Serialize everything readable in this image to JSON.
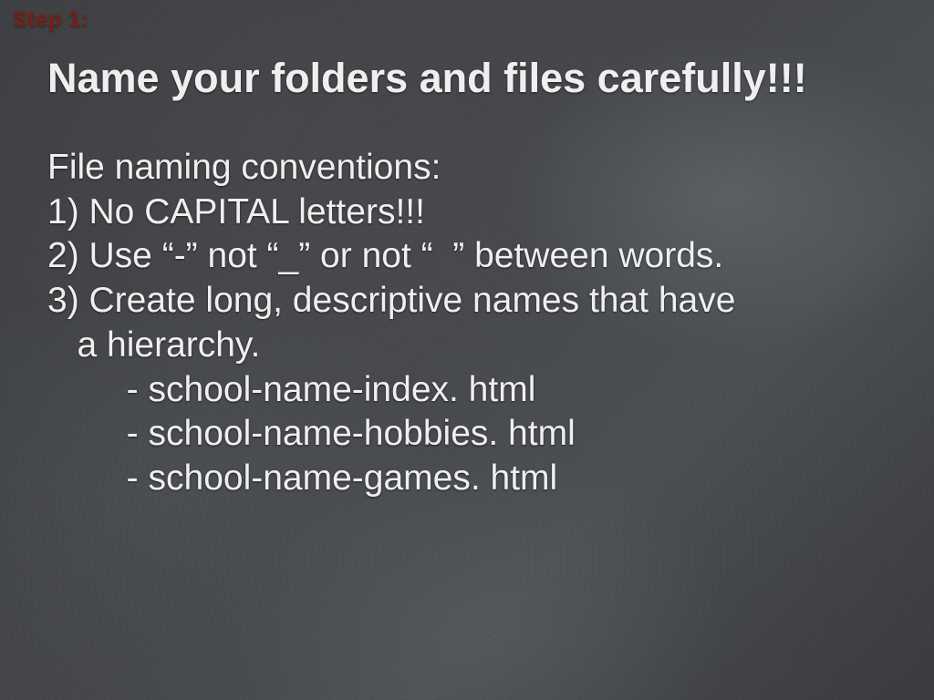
{
  "step_label": "Step 1:",
  "title": "Name your folders and files carefully!!!",
  "body": {
    "subtitle": "File naming conventions:",
    "rule1": "1) No CAPITAL letters!!!",
    "rule2": "2) Use “-” not “_” or not “  ” between words.",
    "rule3a": "3) Create long, descriptive names that have",
    "rule3b": "   a hierarchy.",
    "ex1": "        - school-name-index. html",
    "ex2": "        - school-name-hobbies. html",
    "ex3": "        - school-name-games. html"
  }
}
